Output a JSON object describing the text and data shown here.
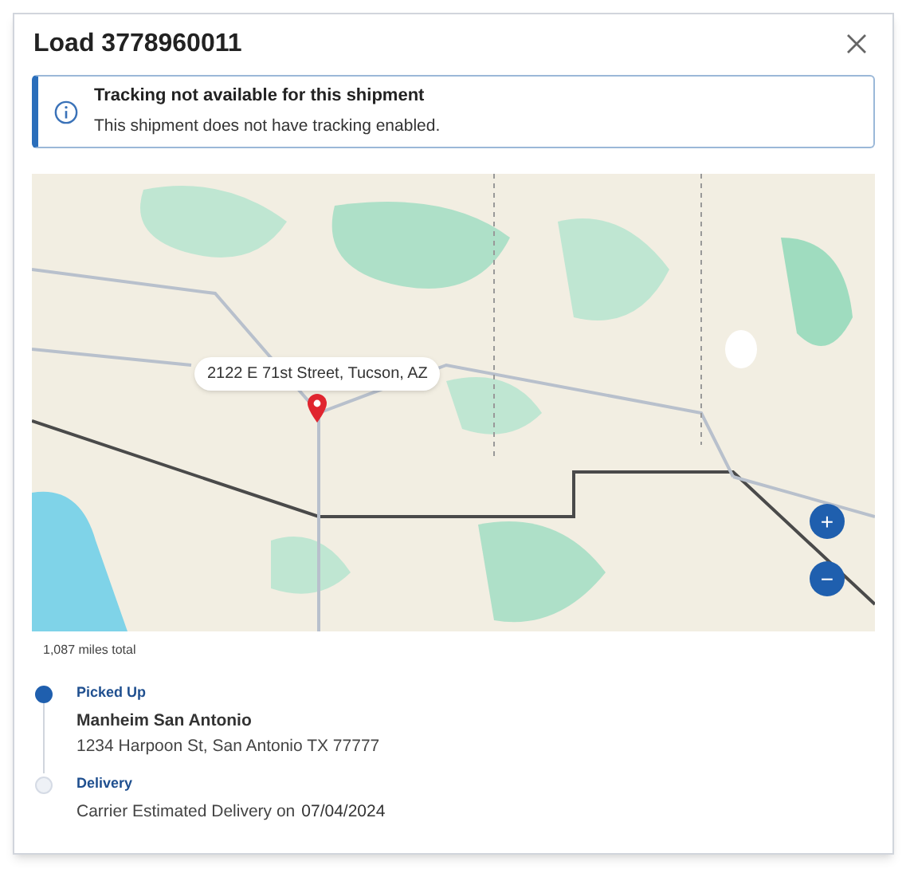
{
  "dialog": {
    "title": "Load 3778960011"
  },
  "alert": {
    "title": "Tracking not available for this shipment",
    "message": "This shipment does not have tracking enabled."
  },
  "map": {
    "pin_label": "2122 E 71st Street, Tucson, AZ",
    "zoom_in": "+",
    "zoom_out": "−"
  },
  "distance": "1,087 miles total",
  "stops": [
    {
      "label": "Picked Up",
      "completed": true,
      "name": "Manheim San Antonio",
      "address": "1234 Harpoon St, San Antonio TX 77777"
    },
    {
      "label": "Delivery",
      "completed": false,
      "note": "Carrier Estimated Delivery on",
      "date": "07/04/2024"
    }
  ]
}
